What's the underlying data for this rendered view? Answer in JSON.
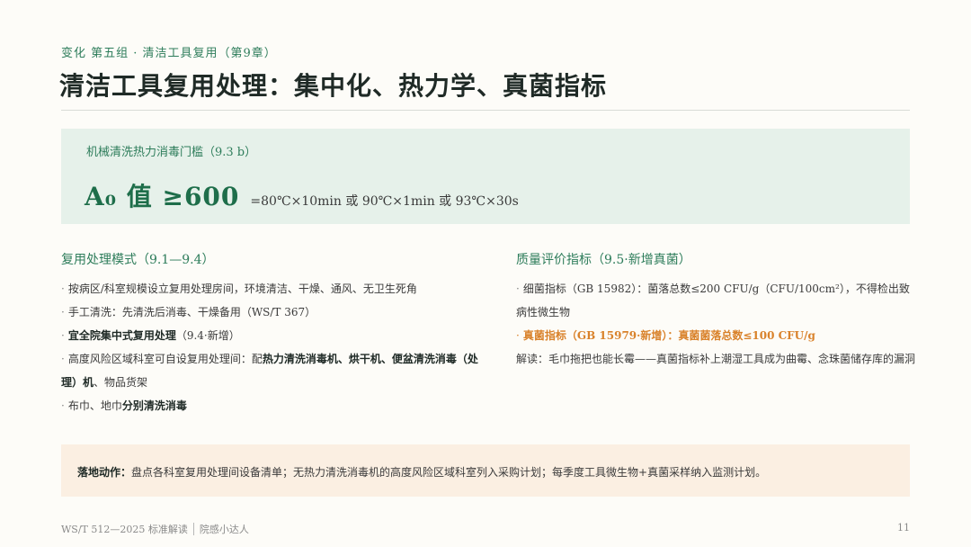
{
  "header": {
    "kicker": "变化  第五组  ·  清洁工具复用（第9章）",
    "title": "清洁工具复用处理：集中化、热力学、真菌指标"
  },
  "hero": {
    "label": "机械清洗热力消毒门槛（9.3 b）",
    "big": "A₀ 值 ≥600",
    "detail": "=80℃×10min  或  90℃×1min  或  93℃×30s"
  },
  "left": {
    "heading": "复用处理模式（9.1—9.4）",
    "items": [
      {
        "pre": "按病区/科室规模设立复用处理房间，环境清洁、干燥、通风、无卫生死角",
        "bold": "",
        "post": ""
      },
      {
        "pre": "手工清洗：先清洗后消毒、干燥备用（WS/T 367）",
        "bold": "",
        "post": ""
      },
      {
        "pre": "",
        "bold": "宜全院集中式复用处理",
        "post": "（9.4·新增）"
      },
      {
        "pre": "高度风险区域科室可自设复用处理间：配",
        "bold": "热力清洗消毒机、烘干机、便盆清洗消毒（处理）机",
        "post": "、物品货架"
      },
      {
        "pre": "布巾、地巾",
        "bold": "分别清洗消毒",
        "post": ""
      }
    ]
  },
  "right": {
    "heading": "质量评价指标（9.5·新增真菌）",
    "items": [
      {
        "text": "细菌指标（GB 15982）：菌落总数≤200 CFU/g（CFU/100cm²），不得检出致病性微生物",
        "highlight": false
      },
      {
        "text": "真菌指标（GB 15979·新增）：真菌菌落总数≤100 CFU/g",
        "highlight": true
      }
    ],
    "note": "解读：毛巾拖把也能长霉——真菌指标补上潮湿工具成为曲霉、念珠菌储存库的漏洞"
  },
  "action": {
    "label": "落地动作：",
    "text": "盘点各科室复用处理间设备清单；无热力清洗消毒机的高度风险区域科室列入采购计划；每季度工具微生物+真菌采样纳入监测计划。"
  },
  "footer": {
    "source": "WS/T 512—2025 标准解读",
    "author": "院感小达人",
    "page": "11"
  },
  "colors": {
    "accent_green": "#2e7d5b",
    "hero_bg": "#e6f1ea",
    "highlight_orange": "#d9822b",
    "action_bg": "#fbefe2"
  }
}
